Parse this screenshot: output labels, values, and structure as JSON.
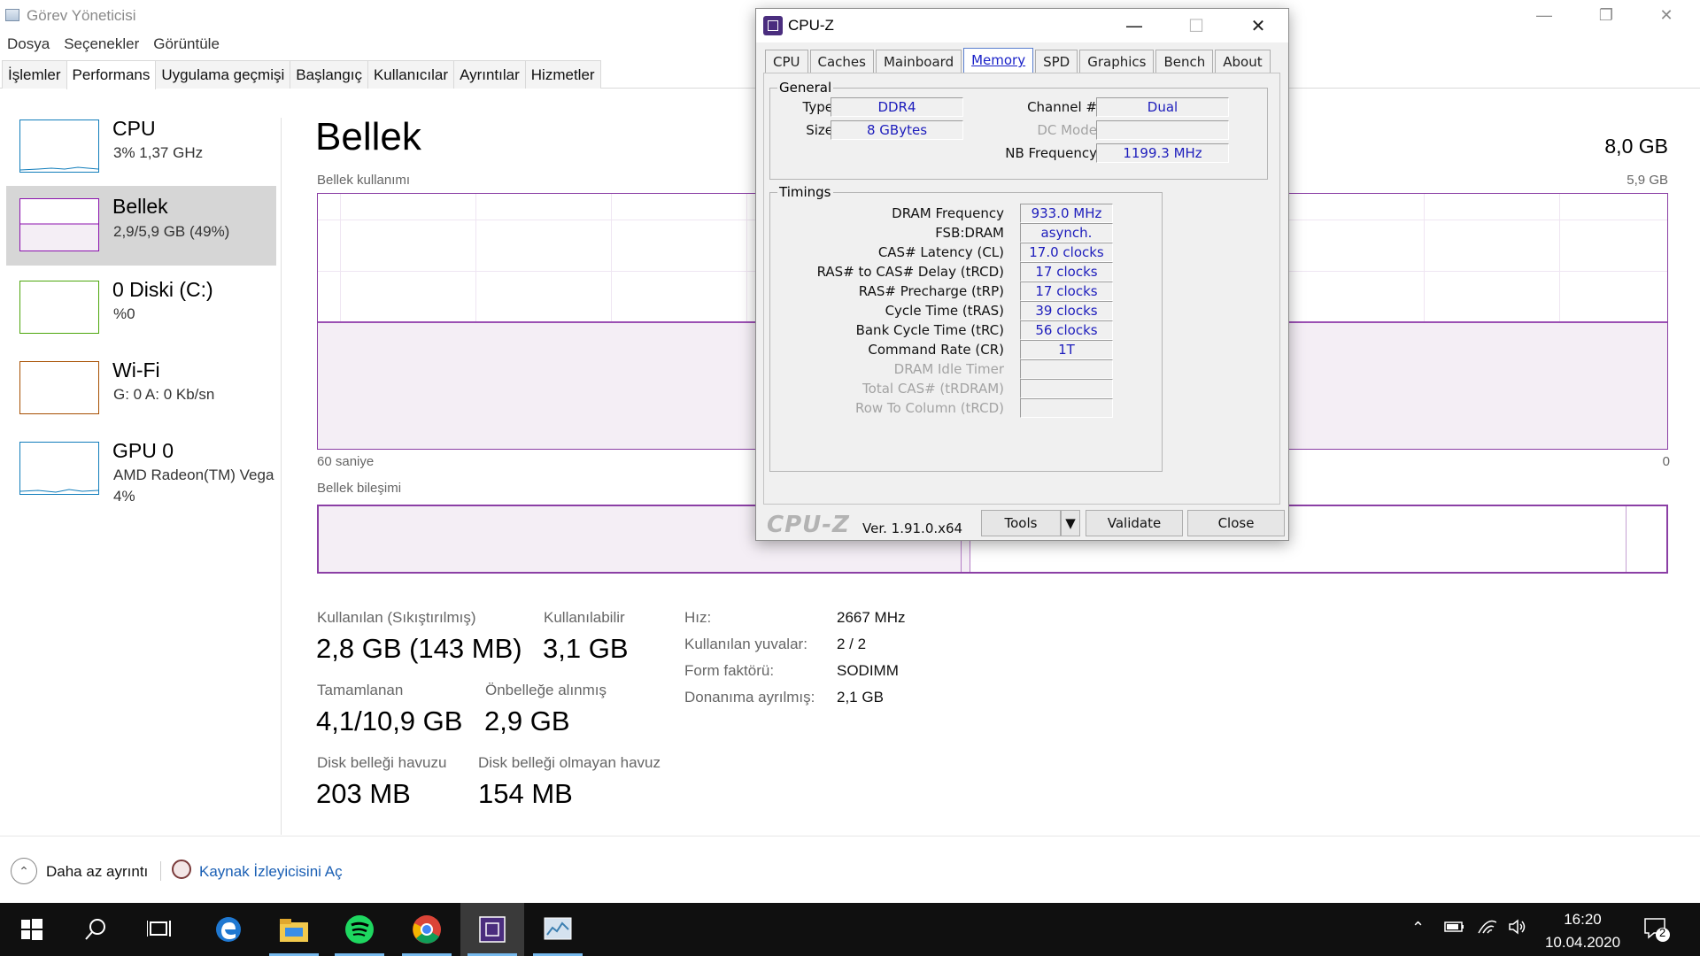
{
  "taskmanager": {
    "title": "Görev Yöneticisi",
    "menu": [
      "Dosya",
      "Seçenekler",
      "Görüntüle"
    ],
    "tabs": [
      "İşlemler",
      "Performans",
      "Uygulama geçmişi",
      "Başlangıç",
      "Kullanıcılar",
      "Ayrıntılar",
      "Hizmetler"
    ],
    "active_tab": "Performans",
    "sidebar": [
      {
        "name": "CPU",
        "sub": "3%  1,37 GHz",
        "color": "#117dbb"
      },
      {
        "name": "Bellek",
        "sub": "2,9/5,9 GB (49%)",
        "color": "#8b12ae"
      },
      {
        "name": "0 Diski (C:)",
        "sub": "%0",
        "color": "#4da60c"
      },
      {
        "name": "Wi-Fi",
        "sub": "G: 0  A: 0 Kb/sn",
        "color": "#a74f01"
      },
      {
        "name": "GPU 0",
        "sub": "AMD Radeon(TM) Vega",
        "sub2": "4%",
        "color": "#117dbb"
      }
    ],
    "main": {
      "title": "Bellek",
      "total": "8,0 GB",
      "usage_label": "Bellek kullanımı",
      "usage_max": "5,9 GB",
      "axis_left": "60 saniye",
      "axis_right": "0",
      "composition_label": "Bellek bileşimi",
      "stats": {
        "used_label": "Kullanılan (Sıkıştırılmış)",
        "used_value": "2,8 GB (143 MB)",
        "available_label": "Kullanılabilir",
        "available_value": "3,1 GB",
        "committed_label": "Tamamlanan",
        "committed_value": "4,1/10,9 GB",
        "cached_label": "Önbelleğe alınmış",
        "cached_value": "2,9 GB",
        "paged_label": "Disk belleği havuzu",
        "paged_value": "203 MB",
        "nonpaged_label": "Disk belleği olmayan havuz",
        "nonpaged_value": "154 MB"
      },
      "details": [
        {
          "label": "Hız:",
          "value": "2667 MHz"
        },
        {
          "label": "Kullanılan yuvalar:",
          "value": "2 / 2"
        },
        {
          "label": "Form faktörü:",
          "value": "SODIMM"
        },
        {
          "label": "Donanıma ayrılmış:",
          "value": "2,1 GB"
        }
      ]
    },
    "footer": {
      "fewer_details": "Daha az ayrıntı",
      "resource_monitor": "Kaynak İzleyicisini Aç"
    }
  },
  "cpuz": {
    "title": "CPU-Z",
    "tabs": [
      "CPU",
      "Caches",
      "Mainboard",
      "Memory",
      "SPD",
      "Graphics",
      "Bench",
      "About"
    ],
    "active_tab": "Memory",
    "general": {
      "legend": "General",
      "type_label": "Type",
      "type_value": "DDR4",
      "size_label": "Size",
      "size_value": "8 GBytes",
      "channel_label": "Channel #",
      "channel_value": "Dual",
      "dcmode_label": "DC Mode",
      "dcmode_value": "",
      "nbfreq_label": "NB Frequency",
      "nbfreq_value": "1199.3 MHz"
    },
    "timings": {
      "legend": "Timings",
      "rows": [
        {
          "label": "DRAM Frequency",
          "value": "933.0 MHz",
          "dim": false
        },
        {
          "label": "FSB:DRAM",
          "value": "asynch.",
          "dim": false
        },
        {
          "label": "CAS# Latency (CL)",
          "value": "17.0 clocks",
          "dim": false
        },
        {
          "label": "RAS# to CAS# Delay (tRCD)",
          "value": "17 clocks",
          "dim": false
        },
        {
          "label": "RAS# Precharge (tRP)",
          "value": "17 clocks",
          "dim": false
        },
        {
          "label": "Cycle Time (tRAS)",
          "value": "39 clocks",
          "dim": false
        },
        {
          "label": "Bank Cycle Time (tRC)",
          "value": "56 clocks",
          "dim": false
        },
        {
          "label": "Command Rate (CR)",
          "value": "1T",
          "dim": false
        },
        {
          "label": "DRAM Idle Timer",
          "value": "",
          "dim": true
        },
        {
          "label": "Total CAS# (tRDRAM)",
          "value": "",
          "dim": true
        },
        {
          "label": "Row To Column (tRCD)",
          "value": "",
          "dim": true
        }
      ]
    },
    "footer": {
      "logo": "CPU-Z",
      "version": "Ver. 1.91.0.x64",
      "tools": "Tools",
      "validate": "Validate",
      "close": "Close"
    }
  },
  "taskbar": {
    "clock_time": "16:20",
    "clock_date": "10.04.2020",
    "notification_count": "2"
  }
}
